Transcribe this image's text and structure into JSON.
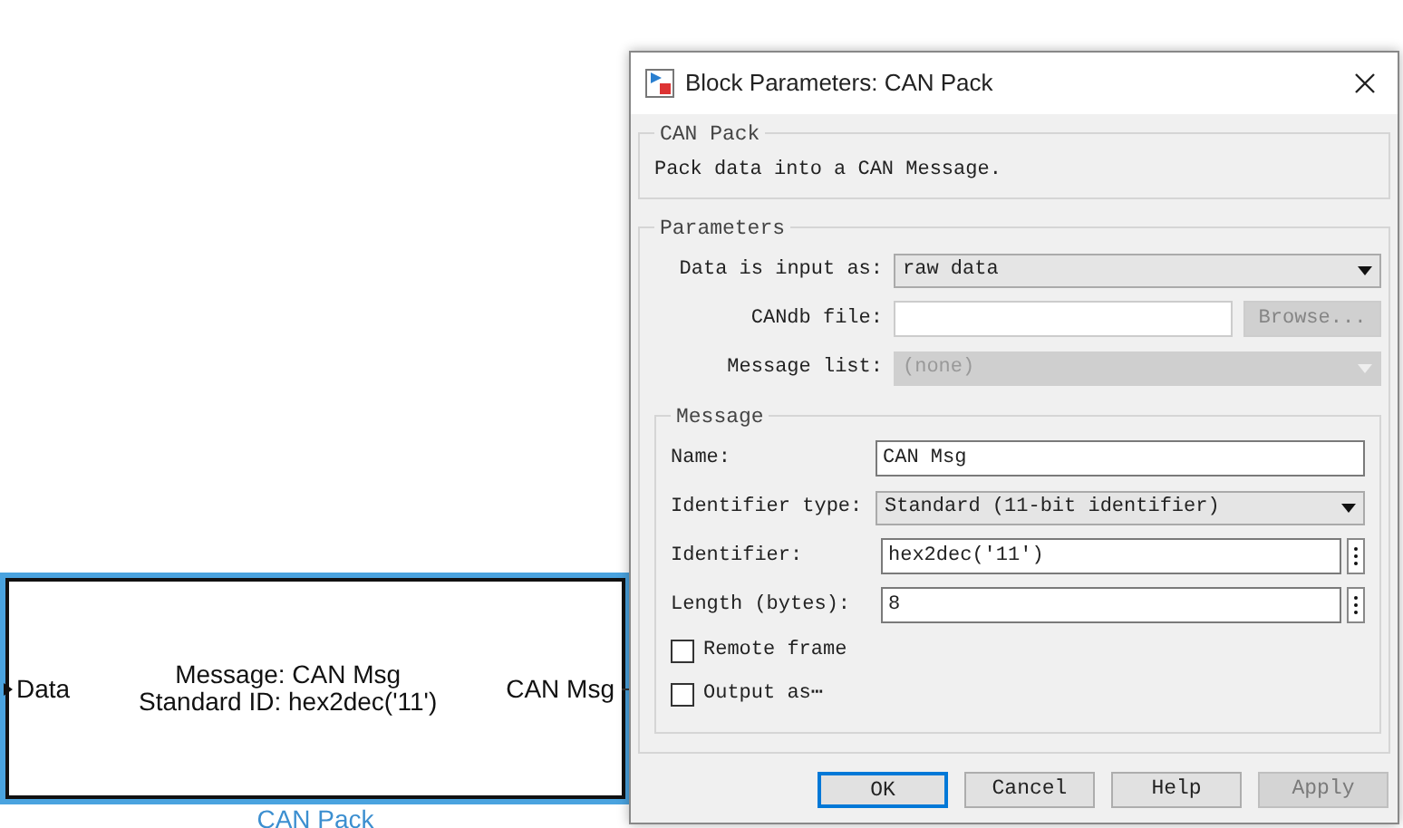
{
  "canvas": {
    "block": {
      "selected": true,
      "input_port": "Data",
      "output_port": "CAN Msg",
      "lines": [
        "Message: CAN Msg",
        "Standard ID: hex2dec('11')"
      ],
      "name": "CAN Pack"
    }
  },
  "dialog": {
    "title": "Block Parameters: CAN Pack",
    "description": {
      "title": "CAN Pack",
      "text": "Pack data into a CAN Message."
    },
    "parameters": {
      "title": "Parameters",
      "fields": [
        {
          "kind": "select",
          "label": "Data is input as:",
          "value": "raw data",
          "disabled": false
        },
        {
          "kind": "file",
          "label": "CANdb file:",
          "button": "Browse...",
          "disabled": true
        },
        {
          "kind": "select",
          "label": "Message list:",
          "value": "(none)",
          "disabled": true
        }
      ]
    },
    "message": {
      "title": "Message",
      "fields": [
        {
          "kind": "text",
          "label": "Name:",
          "value": "CAN Msg"
        },
        {
          "kind": "select",
          "label": "Identifier type:",
          "value": "Standard (11-bit identifier)",
          "disabled": false
        },
        {
          "kind": "param",
          "label": "Identifier:",
          "value": "hex2dec('11')"
        },
        {
          "kind": "param",
          "label": "Length (bytes):",
          "value": "8"
        },
        {
          "kind": "checkbox",
          "label": "Remote frame",
          "checked": false
        },
        {
          "kind": "checkbox",
          "label": "Output as⋯",
          "checked": false
        }
      ]
    },
    "buttons": [
      {
        "label": "OK",
        "default": true,
        "disabled": false
      },
      {
        "label": "Cancel",
        "default": false,
        "disabled": false
      },
      {
        "label": "Help",
        "default": false,
        "disabled": false
      },
      {
        "label": "Apply",
        "default": false,
        "disabled": true
      }
    ]
  }
}
